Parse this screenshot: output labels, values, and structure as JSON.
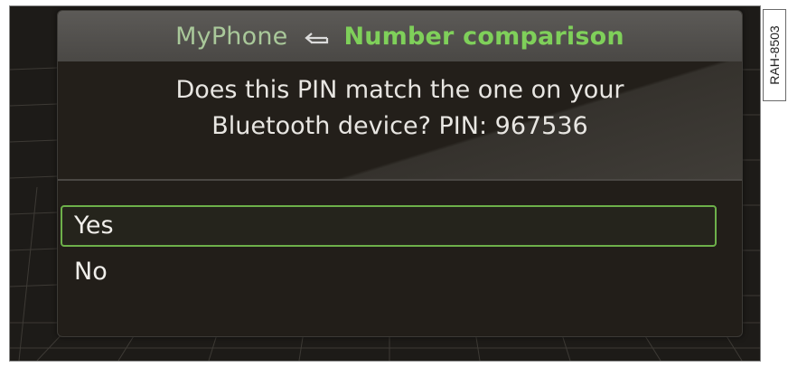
{
  "header": {
    "device_name": "MyPhone",
    "return_icon": "return-arrow-icon",
    "title": "Number comparison"
  },
  "message": {
    "line1": "Does this PIN match the one on your",
    "line2": "Bluetooth device? PIN: 967536"
  },
  "options": [
    {
      "label": "Yes",
      "selected": true
    },
    {
      "label": "No",
      "selected": false
    }
  ],
  "figure_label": "RAH-8503",
  "colors": {
    "title_green": "#7fd05a",
    "device_green": "#a9c89a",
    "selection_border": "#6db04a",
    "dialog_background": "#221e19",
    "header_background": "#4a4845"
  }
}
